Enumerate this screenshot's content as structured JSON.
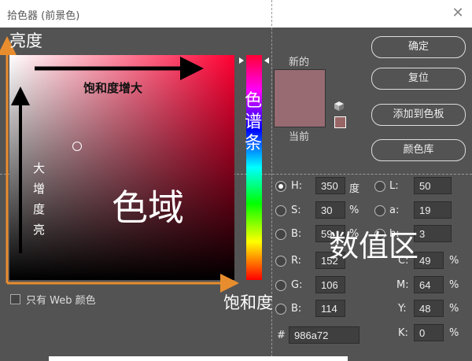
{
  "title": "拾色器 (前景色)",
  "close_icon": "close-icon",
  "colors": {
    "new": "#986a72",
    "current": "#986a72",
    "websafe": "#996666",
    "field_hue": "#ff0033",
    "annotation_orange": "#e88d2e"
  },
  "swatch": {
    "new_label": "新的",
    "current_label": "当前"
  },
  "buttons": {
    "ok": "确定",
    "reset": "复位",
    "add_swatch": "添加到色板",
    "library": "颜色库"
  },
  "hsb": {
    "h": {
      "label": "H:",
      "value": "350",
      "unit": "度"
    },
    "s": {
      "label": "S:",
      "value": "30",
      "unit": "%"
    },
    "b": {
      "label": "B:",
      "value": "59",
      "unit": "%"
    }
  },
  "rgb": {
    "r": {
      "label": "R:",
      "value": "152"
    },
    "g": {
      "label": "G:",
      "value": "106"
    },
    "b": {
      "label": "B:",
      "value": "114"
    }
  },
  "lab": {
    "l": {
      "label": "L:",
      "value": "50"
    },
    "a": {
      "label": "a:",
      "value": "19"
    },
    "b": {
      "label": "b:",
      "value": "3"
    }
  },
  "cmyk": {
    "c": {
      "label": "C:",
      "value": "49",
      "unit": "%"
    },
    "m": {
      "label": "M:",
      "value": "64",
      "unit": "%"
    },
    "y": {
      "label": "Y:",
      "value": "48",
      "unit": "%"
    },
    "k": {
      "label": "K:",
      "value": "0",
      "unit": "%"
    }
  },
  "hex": {
    "label": "#",
    "value": "986a72"
  },
  "web_only": {
    "label": "只有 Web 颜色",
    "checked": false
  },
  "annotations": {
    "brightness": "亮度",
    "saturation_up": "饱和度增大",
    "brightness_up": [
      "大",
      "增",
      "度",
      "亮"
    ],
    "gamut": "色域",
    "spectrum": [
      "色",
      "谱",
      "条"
    ],
    "numeric_area": "数值区",
    "saturation": "饱和度"
  }
}
